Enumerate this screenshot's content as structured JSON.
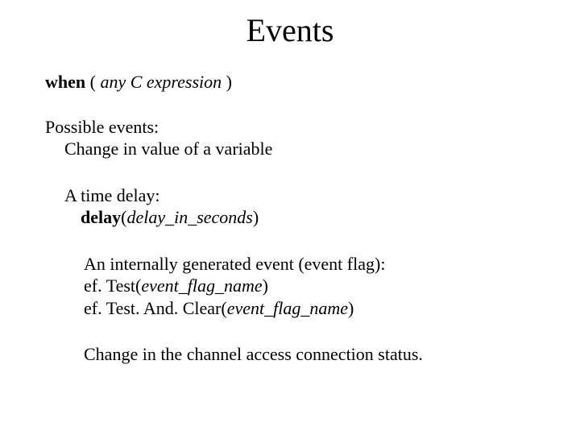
{
  "title": "Events",
  "line1": {
    "when": "when",
    "openParen": " ( ",
    "expr": "any C expression",
    "closeParen": " )"
  },
  "possibleEvents": "Possible events:",
  "changeVar": "Change in value of a variable",
  "timeDelayLabel": "A time delay:",
  "delayCall": {
    "fn": "delay",
    "open": "(",
    "arg": "delay_in_seconds",
    "close": ")"
  },
  "internalEvent": "An internally generated event (event flag):",
  "efTest": {
    "prefix": "ef. Test(",
    "arg": "event_flag_name",
    "suffix": ")"
  },
  "efTestAndClear": {
    "prefix": "ef. Test. And. Clear(",
    "arg": "event_flag_name",
    "suffix": ")"
  },
  "channelStatus": "Change in the channel access connection status."
}
